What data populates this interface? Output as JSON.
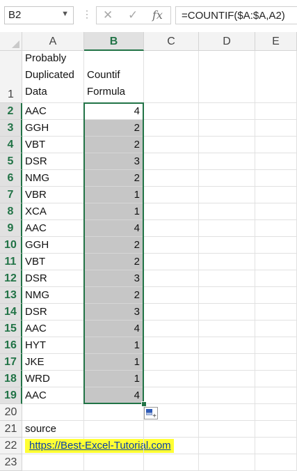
{
  "formula_bar": {
    "name_box": "B2",
    "formula": "=COUNTIF($A:$A,A2)",
    "fx_label": "fx",
    "cancel_glyph": "✕",
    "enter_glyph": "✓"
  },
  "columns": [
    "A",
    "B",
    "C",
    "D",
    "E"
  ],
  "selected_column": "B",
  "headers": {
    "a_lines": [
      "Probably",
      "Duplicated",
      "Data"
    ],
    "b_lines": [
      "Countif",
      "Formula"
    ]
  },
  "rows": [
    {
      "row": "1"
    },
    {
      "row": "2",
      "a": "AAC",
      "b": 4
    },
    {
      "row": "3",
      "a": "GGH",
      "b": 2
    },
    {
      "row": "4",
      "a": "VBT",
      "b": 2
    },
    {
      "row": "5",
      "a": "DSR",
      "b": 3
    },
    {
      "row": "6",
      "a": "NMG",
      "b": 2
    },
    {
      "row": "7",
      "a": "VBR",
      "b": 1
    },
    {
      "row": "8",
      "a": "XCA",
      "b": 1
    },
    {
      "row": "9",
      "a": "AAC",
      "b": 4
    },
    {
      "row": "10",
      "a": "GGH",
      "b": 2
    },
    {
      "row": "11",
      "a": "VBT",
      "b": 2
    },
    {
      "row": "12",
      "a": "DSR",
      "b": 3
    },
    {
      "row": "13",
      "a": "NMG",
      "b": 2
    },
    {
      "row": "14",
      "a": "DSR",
      "b": 3
    },
    {
      "row": "15",
      "a": "AAC",
      "b": 4
    },
    {
      "row": "16",
      "a": "HYT",
      "b": 1
    },
    {
      "row": "17",
      "a": "JKE",
      "b": 1
    },
    {
      "row": "18",
      "a": "WRD",
      "b": 1
    },
    {
      "row": "19",
      "a": "AAC",
      "b": 4
    },
    {
      "row": "20"
    },
    {
      "row": "21",
      "a": "source"
    },
    {
      "row": "22",
      "a": "https://Best-Excel-Tutorial.com"
    },
    {
      "row": "23"
    }
  ],
  "colors": {
    "excel_green": "#217346",
    "selection_shade": "#c6c6c6",
    "link_highlight": "#ffff33",
    "link_text": "#0a3fa8"
  },
  "icons": {
    "quick_analysis": "quick-analysis-icon",
    "fill_handle": "fill-handle"
  }
}
